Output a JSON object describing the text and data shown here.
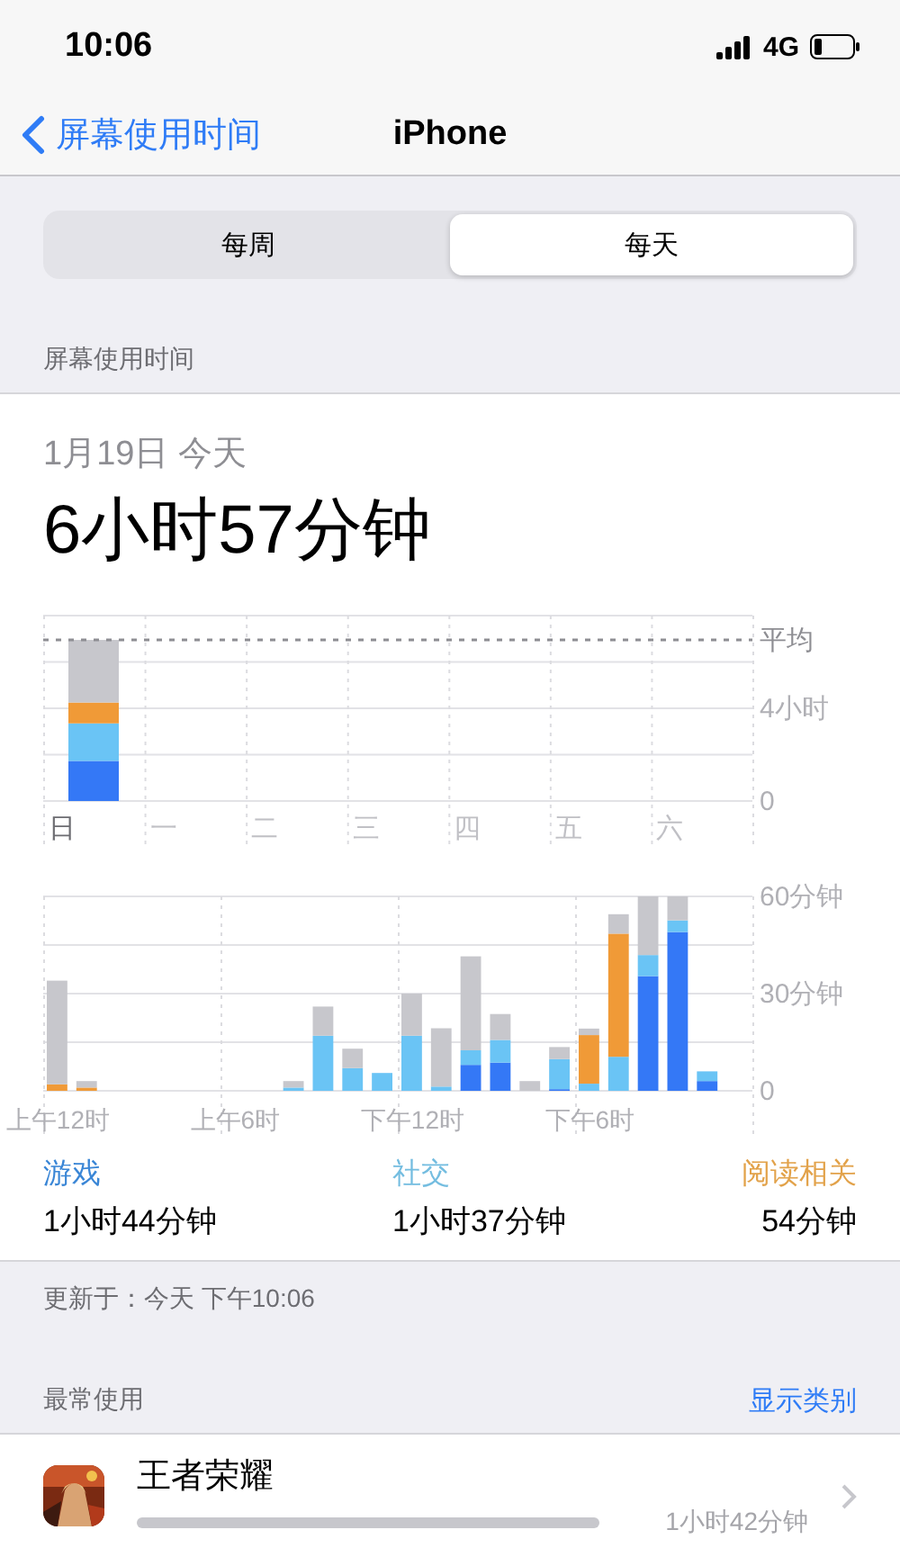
{
  "status_bar": {
    "time": "10:06",
    "network": "4G"
  },
  "nav": {
    "back": "屏幕使用时间",
    "title": "iPhone"
  },
  "tabs": [
    {
      "label": "每周",
      "selected": false
    },
    {
      "label": "每天",
      "selected": true
    }
  ],
  "section_title": "屏幕使用时间",
  "summary": {
    "date": "1月19日 今天",
    "total": "6小时57分钟"
  },
  "weekly_chart": {
    "chart_data": {
      "type": "bar",
      "stacked": true,
      "categories": [
        "日",
        "一",
        "二",
        "三",
        "四",
        "五",
        "六"
      ],
      "ylim": [
        0,
        8
      ],
      "yticks": [
        0,
        {
          "value": 4,
          "label": "4小时"
        }
      ],
      "ref_lines": [
        {
          "axis": "y",
          "value": 6.95,
          "label": "平均"
        }
      ],
      "grid": true,
      "series": [
        {
          "color": "#3478f6",
          "values": [
            1.73,
            null,
            null,
            null,
            null,
            null,
            null
          ]
        },
        {
          "color": "#6ac4f5",
          "values": [
            1.62,
            null,
            null,
            null,
            null,
            null,
            null
          ]
        },
        {
          "color": "#f09a37",
          "values": [
            0.9,
            null,
            null,
            null,
            null,
            null,
            null
          ]
        },
        {
          "color": "#c7c7cc",
          "values": [
            2.7,
            null,
            null,
            null,
            null,
            null,
            null
          ]
        }
      ]
    }
  },
  "hourly_chart": {
    "chart_data": {
      "type": "bar",
      "stacked": true,
      "categories": [
        "上午12时",
        null,
        null,
        null,
        null,
        null,
        "上午6时",
        null,
        null,
        null,
        null,
        null,
        "下午12时",
        null,
        null,
        null,
        null,
        null,
        "下午6时",
        null,
        null,
        null,
        null,
        null
      ],
      "ylim": [
        0,
        60
      ],
      "grid": true,
      "yticks": [
        0,
        {
          "value": 30,
          "label": "30分钟"
        },
        {
          "value": 60,
          "label": "60分钟"
        }
      ],
      "series": [
        {
          "color": "#3478f6",
          "values": [
            null,
            null,
            null,
            null,
            null,
            null,
            null,
            null,
            null,
            null,
            null,
            null,
            null,
            null,
            8,
            8.7,
            null,
            0.5,
            null,
            null,
            35.4,
            49,
            3,
            null
          ]
        },
        {
          "color": "#6ac4f5",
          "values": [
            null,
            null,
            null,
            null,
            null,
            null,
            null,
            null,
            1,
            17,
            7,
            5.5,
            17,
            1.3,
            4.5,
            7,
            null,
            9.3,
            2.2,
            10.5,
            6.5,
            3.6,
            3,
            null
          ]
        },
        {
          "color": "#f09a37",
          "values": [
            2,
            1,
            null,
            null,
            null,
            null,
            null,
            null,
            null,
            null,
            null,
            null,
            null,
            null,
            null,
            null,
            null,
            null,
            15,
            38,
            null,
            null,
            null,
            null
          ]
        },
        {
          "color": "#c7c7cc",
          "values": [
            32,
            2,
            null,
            null,
            null,
            null,
            null,
            null,
            2,
            9,
            6,
            null,
            13,
            18,
            29,
            8,
            3,
            3.7,
            2,
            6,
            18.1,
            7.4,
            null,
            null
          ]
        }
      ]
    }
  },
  "categories": [
    {
      "name": "游戏",
      "time": "1小时44分钟",
      "color": "#3a86d6"
    },
    {
      "name": "社交",
      "time": "1小时37分钟",
      "color": "#74bde0"
    },
    {
      "name": "阅读相关",
      "time": "54分钟",
      "color": "#e2a24a"
    }
  ],
  "updated": "更新于：今天 下午10:06",
  "most_used": {
    "title": "最常使用",
    "link": "显示类别"
  },
  "apps": [
    {
      "kind": "picture",
      "name": "王者荣耀",
      "time": "1小时42分钟"
    }
  ]
}
